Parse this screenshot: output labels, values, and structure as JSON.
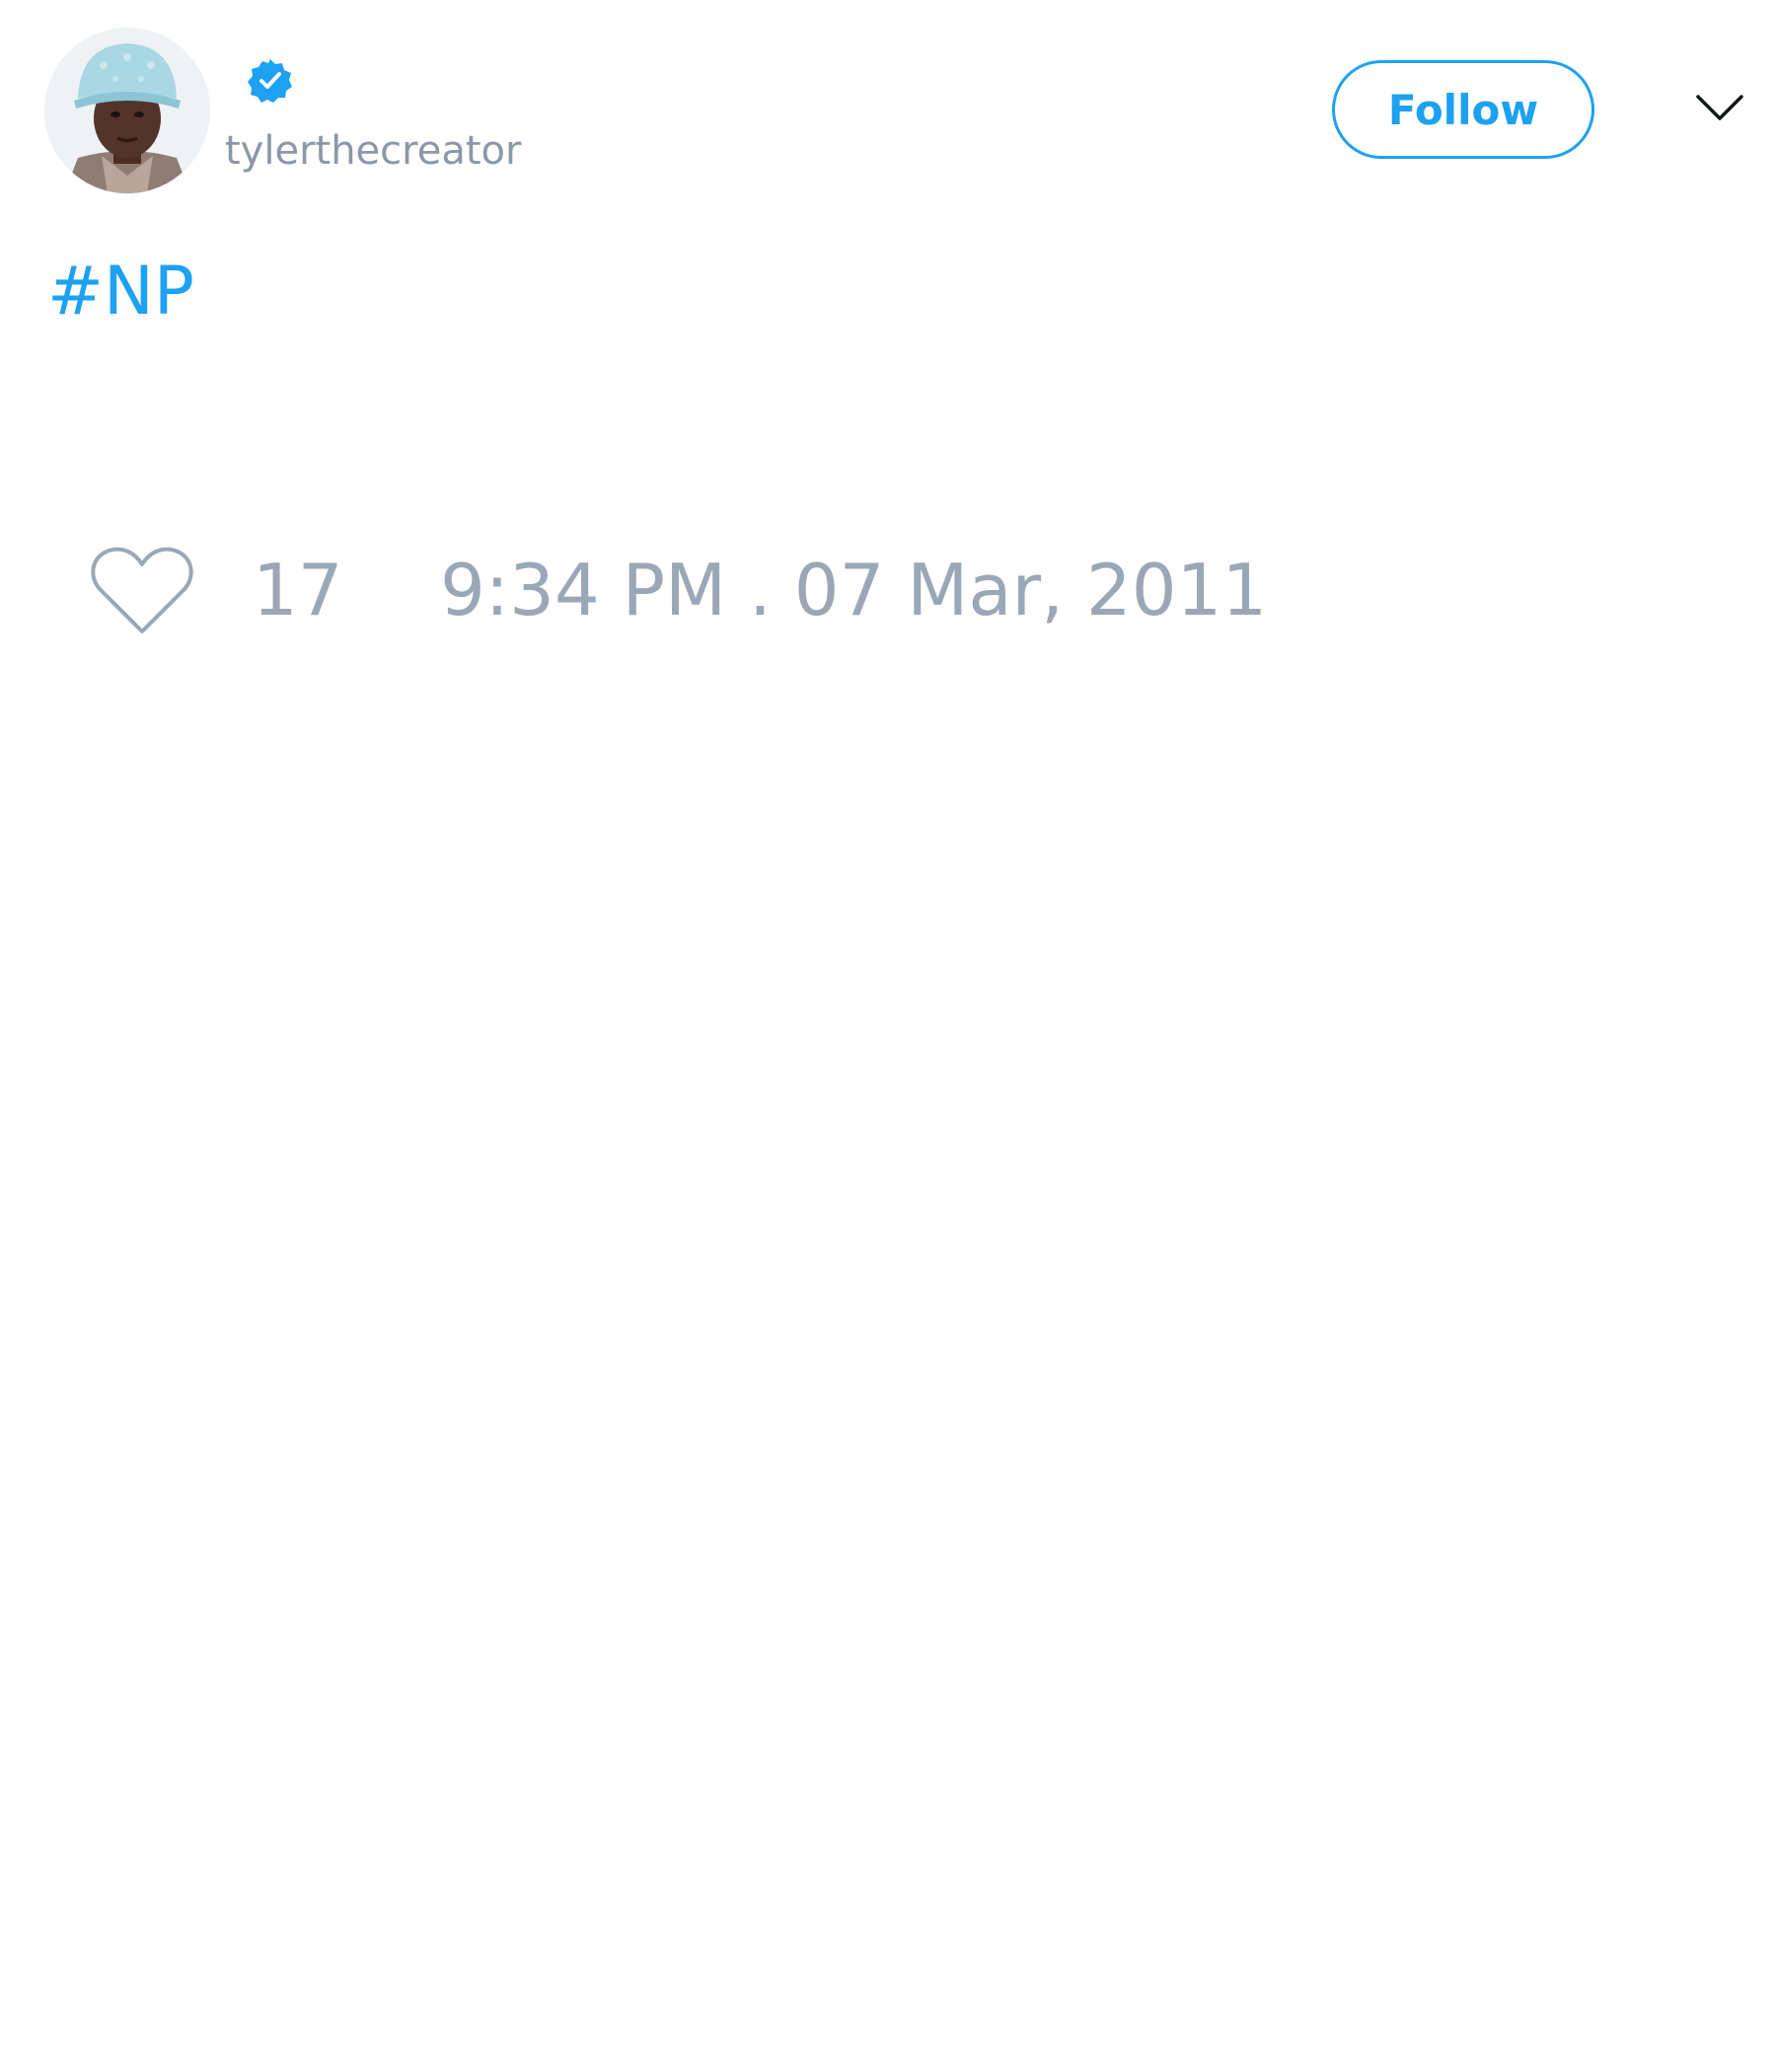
{
  "user": {
    "handle": "tylerthecreator",
    "verified": true,
    "avatar_icon": "profile-photo"
  },
  "actions": {
    "follow_label": "Follow",
    "menu_icon": "chevron-down-icon"
  },
  "tweet": {
    "text": "#NP",
    "likes": "17",
    "timestamp": "9:34 PM . 07 Mar, 2011"
  },
  "colors": {
    "accent": "#1da1f2",
    "muted": "#9aa7b6",
    "background": "#ffffff"
  }
}
